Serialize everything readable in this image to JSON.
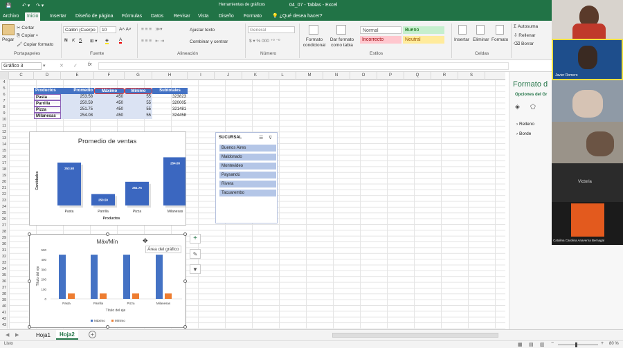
{
  "titlebar": {
    "qat_file": "💾",
    "doc_title": "04_07 - Tablas - Excel",
    "context_title": "Herramientas de gráficos"
  },
  "tabs": [
    {
      "label": "Archivo"
    },
    {
      "label": "Inicio"
    },
    {
      "label": "Insertar"
    },
    {
      "label": "Diseño de página"
    },
    {
      "label": "Fórmulas"
    },
    {
      "label": "Datos"
    },
    {
      "label": "Revisar"
    },
    {
      "label": "Vista"
    },
    {
      "label": "Diseño"
    },
    {
      "label": "Formato"
    }
  ],
  "tell_me": "¿Qué desea hacer?",
  "ribbon": {
    "clipboard": {
      "paste": "Pegar",
      "cut": "Cortar",
      "copy": "Copiar",
      "format_painter": "Copiar formato",
      "group": "Portapapeles"
    },
    "font": {
      "name": "Calibri (Cuerpo",
      "size": "10",
      "group": "Fuente"
    },
    "alignment": {
      "wrap": "Ajustar texto",
      "merge": "Combinar y centrar",
      "group": "Alineación"
    },
    "number": {
      "format": "General",
      "group": "Número"
    },
    "styles": {
      "cond": "Formato condicional",
      "table": "Dar formato como tabla",
      "normal": "Normal",
      "bueno": "Bueno",
      "incorrecto": "Incorrecto",
      "neutral": "Neutral",
      "group": "Estilos"
    },
    "cells": {
      "insert": "Insertar",
      "delete": "Eliminar",
      "format": "Formato",
      "group": "Celdas"
    },
    "editing": {
      "autosum": "Autosuma",
      "fill": "Rellenar",
      "clear": "Borrar"
    }
  },
  "namebox": "Gráfico 3",
  "columns": [
    "C",
    "D",
    "E",
    "F",
    "G",
    "H",
    "I",
    "J",
    "K",
    "L",
    "M",
    "N",
    "O",
    "P",
    "Q",
    "R",
    "S"
  ],
  "rows": [
    "4",
    "5",
    "6",
    "7",
    "8",
    "9",
    "10",
    "11",
    "12",
    "13",
    "14",
    "15",
    "16",
    "17",
    "18",
    "19",
    "20",
    "21",
    "22",
    "23",
    "24",
    "25",
    "26",
    "27",
    "28",
    "29",
    "30",
    "31",
    "32",
    "33",
    "34",
    "35",
    "36",
    "37",
    "38",
    "39",
    "40",
    "41",
    "42",
    "43"
  ],
  "table": {
    "headers": [
      "Productos",
      "Promedio",
      "Máximo",
      "Mínimo",
      "Subtotales"
    ],
    "rows": [
      [
        "Pasta",
        "253.58",
        "450",
        "55",
        "323823"
      ],
      [
        "Parrilla",
        "250.59",
        "450",
        "55",
        "320005"
      ],
      [
        "Pizza",
        "251.75",
        "450",
        "55",
        "321481"
      ],
      [
        "Milanesas",
        "254.08",
        "450",
        "55",
        "324458"
      ]
    ]
  },
  "chart_data": [
    {
      "type": "bar",
      "title": "Promedio de ventas",
      "xlabel": "Productos",
      "ylabel": "Cantidades",
      "categories": [
        "Pasta",
        "Parrilla",
        "Pizza",
        "Milanesas"
      ],
      "values": [
        253.58,
        250.59,
        251.75,
        254.08
      ],
      "labels": [
        "253.58",
        "250.59",
        "251.75",
        "254.08"
      ]
    },
    {
      "type": "bar",
      "title": "Máx/Mín",
      "xlabel": "Título del eje",
      "ylabel": "Título del eje",
      "categories": [
        "Pasta",
        "Parrilla",
        "Pizza",
        "Milanesas"
      ],
      "ylim": [
        0,
        500
      ],
      "yticks": [
        "0",
        "100",
        "200",
        "300",
        "400",
        "500"
      ],
      "series": [
        {
          "name": "Máximo",
          "values": [
            450,
            450,
            450,
            450
          ],
          "color": "#4472c4"
        },
        {
          "name": "Mínimo",
          "values": [
            55,
            55,
            55,
            55
          ],
          "color": "#ed7d31"
        }
      ],
      "legend": "bottom"
    }
  ],
  "chart_tooltip": "Área del gráfico",
  "slicer": {
    "title": "SUCURSAL",
    "items": [
      "Buenos Aires",
      "Maldonado",
      "Montevideo",
      "Paysandú",
      "Rivera",
      "Tacuarembo"
    ]
  },
  "sheets": [
    {
      "label": "Hoja1"
    },
    {
      "label": "Hoja2"
    }
  ],
  "add_sheet": "+",
  "status": {
    "left": "Listo",
    "zoom": "80 %"
  },
  "pane": {
    "title": "Formato d",
    "subtitle": "Opciones del Gr",
    "fill": "Relleno",
    "border": "Borde"
  },
  "video": [
    {
      "name": "Javier Romero"
    },
    {
      "name": "Victoria"
    },
    {
      "name": "Catalina Carolina Anaverna Bernagal"
    }
  ],
  "colors": {
    "excel_green": "#217346",
    "bar_blue": "#4472c4",
    "bar_orange": "#ed7d31",
    "header_blue": "#4472c4"
  }
}
